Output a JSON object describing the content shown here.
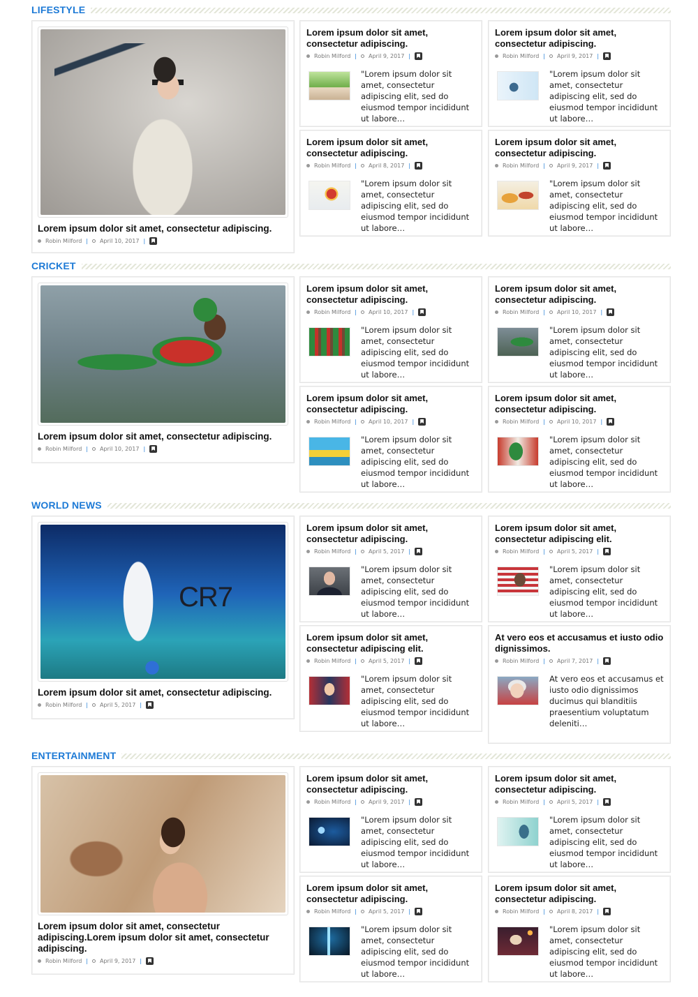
{
  "sections": [
    {
      "title": "LIFESTYLE",
      "featured": {
        "title": "Lorem ipsum dolor sit amet, consectetur adipiscing.",
        "author": "Robin Milford",
        "date": "April 10, 2017",
        "image": "woman-sunglasses-scarf-photo"
      },
      "items": [
        {
          "title": "Lorem ipsum dolor sit amet, consectetur adipiscing.",
          "author": "Robin Milford",
          "date": "April 9, 2017",
          "excerpt": "\"Lorem ipsum dolor sit amet, consectetur adipiscing elit, sed do eiusmod tempor incididunt ut labore…",
          "thumb": "children-park-photo"
        },
        {
          "title": "Lorem ipsum dolor sit amet, consectetur adipiscing.",
          "author": "Robin Milford",
          "date": "April 9, 2017",
          "excerpt": "\"Lorem ipsum dolor sit amet, consectetur adipiscing elit, sed do eiusmod tempor incididunt ut labore…",
          "thumb": "family-window-photo"
        },
        {
          "title": "Lorem ipsum dolor sit amet, consectetur adipiscing.",
          "author": "Robin Milford",
          "date": "April 8, 2017",
          "excerpt": "\"Lorem ipsum dolor sit amet, consectetur adipiscing elit, sed do eiusmod tempor incididunt ut labore…",
          "thumb": "heart-health-illustration"
        },
        {
          "title": "Lorem ipsum dolor sit amet, consectetur adipiscing.",
          "author": "Robin Milford",
          "date": "April 9, 2017",
          "excerpt": "\"Lorem ipsum dolor sit amet, consectetur adipiscing elit, sed do eiusmod tempor incididunt ut labore…",
          "thumb": "food-plate-photo"
        }
      ]
    },
    {
      "title": "CRICKET",
      "featured": {
        "title": "Lorem ipsum dolor sit amet, consectetur adipiscing.",
        "author": "Robin Milford",
        "date": "April 10, 2017",
        "image": "cricket-fielder-diving-photo"
      },
      "items": [
        {
          "title": "Lorem ipsum dolor sit amet, consectetur adipiscing.",
          "author": "Robin Milford",
          "date": "April 10, 2017",
          "excerpt": "\"Lorem ipsum dolor sit amet, consectetur adipiscing elit, sed do eiusmod tempor incididunt ut labore…",
          "thumb": "cricket-team-photo"
        },
        {
          "title": "Lorem ipsum dolor sit amet, consectetur adipiscing.",
          "author": "Robin Milford",
          "date": "April 10, 2017",
          "excerpt": "\"Lorem ipsum dolor sit amet, consectetur adipiscing elit, sed do eiusmod tempor incididunt ut labore…",
          "thumb": "cricket-dive-photo"
        },
        {
          "title": "Lorem ipsum dolor sit amet, consectetur adipiscing.",
          "author": "Robin Milford",
          "date": "April 10, 2017",
          "excerpt": "\"Lorem ipsum dolor sit amet, consectetur adipiscing elit, sed do eiusmod tempor incididunt ut labore…",
          "thumb": "cricket-cartoon-photo"
        },
        {
          "title": "Lorem ipsum dolor sit amet, consectetur adipiscing.",
          "author": "Robin Milford",
          "date": "April 10, 2017",
          "excerpt": "\"Lorem ipsum dolor sit amet, consectetur adipiscing elit, sed do eiusmod tempor incididunt ut labore…",
          "thumb": "cricket-player-photo"
        }
      ]
    },
    {
      "title": "WORLD NEWS",
      "featured": {
        "title": "Lorem ipsum dolor sit amet, consectetur adipiscing.",
        "author": "Robin Milford",
        "date": "April 5, 2017",
        "image": "footballer-cr7-photo",
        "overlay_text": "CR7"
      },
      "items": [
        {
          "title": "Lorem ipsum dolor sit amet, consectetur adipiscing.",
          "author": "Robin Milford",
          "date": "April 5, 2017",
          "excerpt": "\"Lorem ipsum dolor sit amet, consectetur adipiscing elit, sed do eiusmod tempor incididunt ut labore…",
          "thumb": "politician-photo"
        },
        {
          "title": "Lorem ipsum dolor sit amet, consectetur adipiscing elit.",
          "author": "Robin Milford",
          "date": "April 5, 2017",
          "excerpt": "\"Lorem ipsum dolor sit amet, consectetur adipiscing elit, sed do eiusmod tempor incididunt ut labore…",
          "thumb": "president-flag-photo"
        },
        {
          "title": "Lorem ipsum dolor sit amet, consectetur adipiscing elit.",
          "author": "Robin Milford",
          "date": "April 5, 2017",
          "excerpt": "\"Lorem ipsum dolor sit amet, consectetur adipiscing elit, sed do eiusmod tempor incididunt ut labore…",
          "thumb": "rally-speech-photo"
        },
        {
          "title": "At vero eos et accusamus et iusto odio dignissimos.",
          "author": "Robin Milford",
          "date": "April 7, 2017",
          "excerpt": "At vero eos et accusamus et iusto odio dignissimos ducimus qui blanditiis praesentium voluptatum deleniti…",
          "thumb": "elderly-woman-photo"
        }
      ]
    },
    {
      "title": "ENTERTAINMENT",
      "featured": {
        "title": "Lorem ipsum dolor sit amet, consectetur adipiscing.Lorem ipsum dolor sit amet, consectetur adipiscing.",
        "author": "Robin Milford",
        "date": "April 9, 2017",
        "image": "actress-wall-photo"
      },
      "items": [
        {
          "title": "Lorem ipsum dolor sit amet, consectetur adipiscing.",
          "author": "Robin Milford",
          "date": "April 9, 2017",
          "excerpt": "\"Lorem ipsum dolor sit amet, consectetur adipiscing elit, sed do eiusmod tempor incididunt ut labore…",
          "thumb": "film-camera-photo"
        },
        {
          "title": "Lorem ipsum dolor sit amet, consectetur adipiscing.",
          "author": "Robin Milford",
          "date": "April 5, 2017",
          "excerpt": "\"Lorem ipsum dolor sit amet, consectetur adipiscing elit, sed do eiusmod tempor incididunt ut labore…",
          "thumb": "woman-pose-photo"
        },
        {
          "title": "Lorem ipsum dolor sit amet, consectetur adipiscing.",
          "author": "Robin Milford",
          "date": "April 5, 2017",
          "excerpt": "\"Lorem ipsum dolor sit amet, consectetur adipiscing elit, sed do eiusmod tempor incididunt ut labore…",
          "thumb": "stage-light-photo"
        },
        {
          "title": "Lorem ipsum dolor sit amet, consectetur adipiscing.",
          "author": "Robin Milford",
          "date": "April 8, 2017",
          "excerpt": "\"Lorem ipsum dolor sit amet, consectetur adipiscing elit, sed do eiusmod tempor incididunt ut labore…",
          "thumb": "concert-crowd-photo"
        }
      ]
    }
  ],
  "colors": {
    "accent": "#1d7ad6",
    "border": "#e4e4e4"
  }
}
